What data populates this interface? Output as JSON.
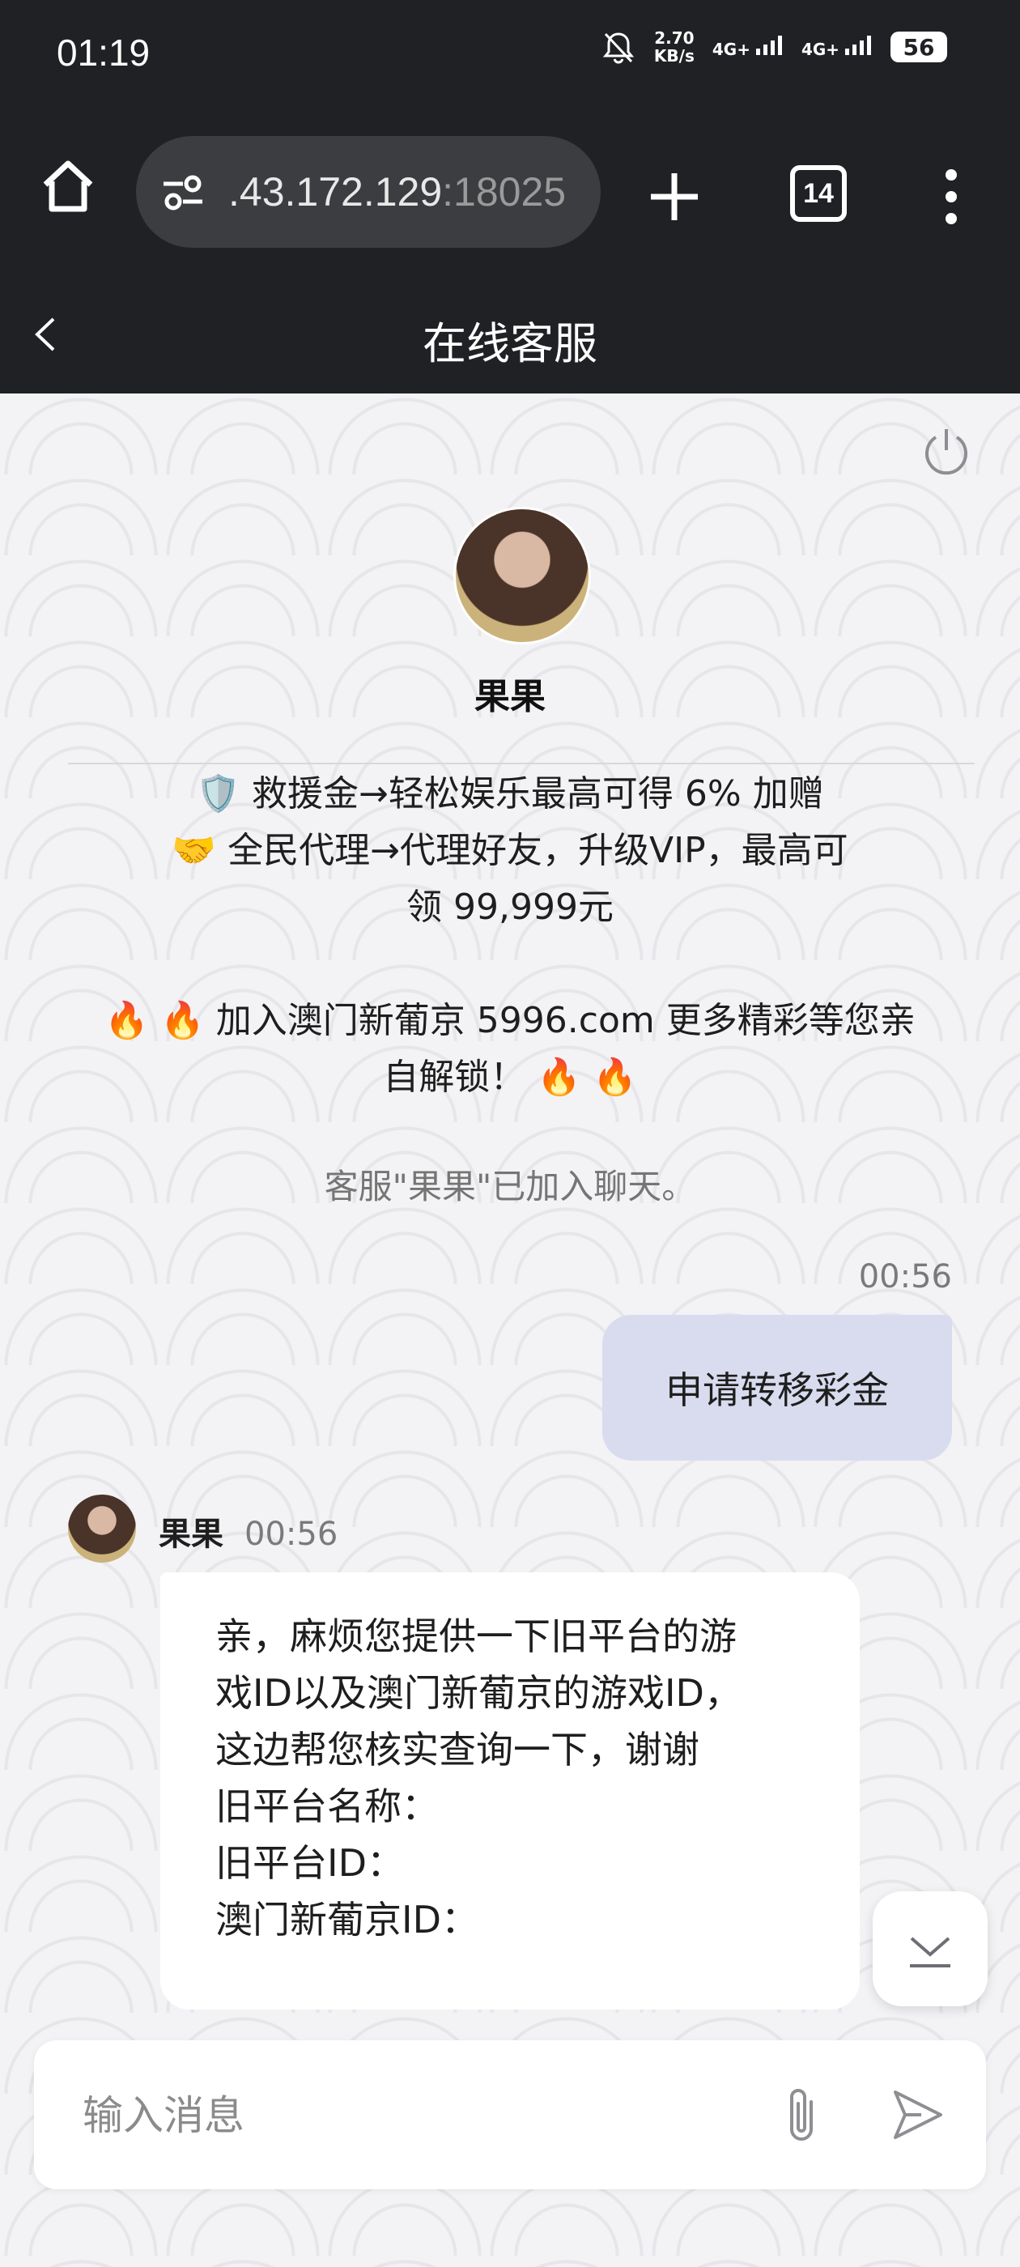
{
  "status_bar": {
    "time": "01:19",
    "net_speed_value": "2.70",
    "net_speed_unit": "KB/s",
    "signal1": "4G+",
    "signal2": "4G+",
    "battery": "56"
  },
  "browser": {
    "url_host": ".43.172.129",
    "url_port": ":18025",
    "tabs_count": "14"
  },
  "header": {
    "title": "在线客服"
  },
  "agent": {
    "name": "果果"
  },
  "promo_lines": [
    "🛡️ 救援金→轻松娱乐最高可得 6% 加赠",
    "🤝 全民代理→代理好友，升级VIP，最高可",
    "领 99,999元",
    "",
    "🔥 🔥 加入澳门新葡京 5996.com 更多精彩等您亲",
    "自解锁！ 🔥 🔥"
  ],
  "system_note": "客服\"果果\"已加入聊天。",
  "messages": {
    "user_time": "00:56",
    "user_text": "申请转移彩金",
    "agent_name": "果果",
    "agent_time": "00:56",
    "agent_lines": [
      "亲，麻烦您提供一下旧平台的游",
      "戏ID以及澳门新葡京的游戏ID，",
      "这边帮您核实查询一下，谢谢",
      "旧平台名称：",
      "旧平台ID：",
      "澳门新葡京ID："
    ]
  },
  "composer": {
    "placeholder": "输入消息"
  }
}
